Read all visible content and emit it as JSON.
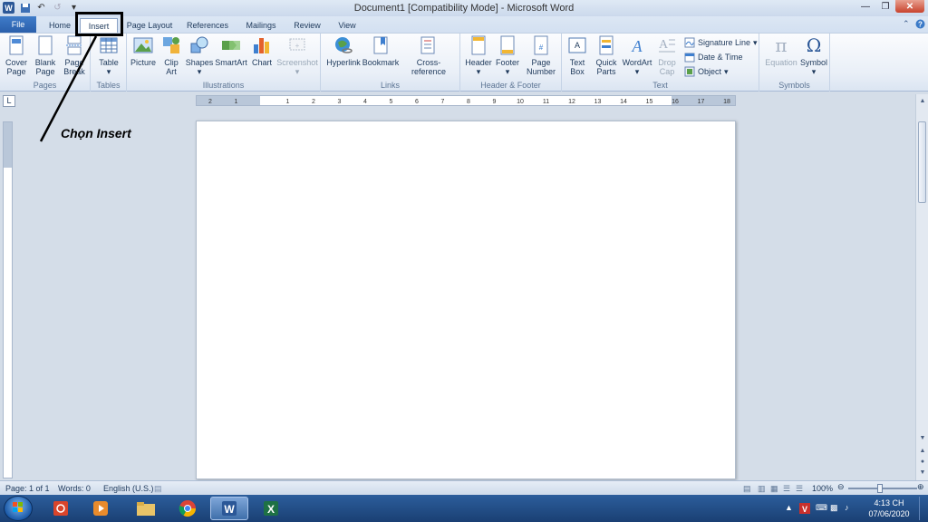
{
  "window": {
    "title": "Document1 [Compatibility Mode] - Microsoft Word",
    "app_icon": "word-icon"
  },
  "tabs": [
    {
      "label": "File"
    },
    {
      "label": "Home"
    },
    {
      "label": "Insert",
      "selected": true
    },
    {
      "label": "Page Layout"
    },
    {
      "label": "References"
    },
    {
      "label": "Mailings"
    },
    {
      "label": "Review"
    },
    {
      "label": "View"
    }
  ],
  "ribbon": {
    "groups": {
      "pages": "Pages",
      "tables": "Tables",
      "illustrations": "Illustrations",
      "links": "Links",
      "header_footer": "Header & Footer",
      "text": "Text",
      "symbols": "Symbols"
    },
    "buttons": {
      "cover_page": [
        "Cover",
        "Page"
      ],
      "blank_page": [
        "Blank",
        "Page"
      ],
      "page_break": [
        "Page",
        "Break"
      ],
      "table": "Table",
      "picture": "Picture",
      "clip_art": [
        "Clip",
        "Art"
      ],
      "shapes": "Shapes",
      "smartart": "SmartArt",
      "chart": "Chart",
      "screenshot": "Screenshot",
      "hyperlink": "Hyperlink",
      "bookmark": "Bookmark",
      "cross_reference": "Cross-reference",
      "header": "Header",
      "footer": "Footer",
      "page_number": [
        "Page",
        "Number"
      ],
      "text_box": [
        "Text",
        "Box"
      ],
      "quick_parts": [
        "Quick",
        "Parts"
      ],
      "wordart": "WordArt",
      "drop_cap": [
        "Drop",
        "Cap"
      ],
      "signature_line": "Signature Line",
      "date_time": "Date & Time",
      "object": "Object",
      "equation": "Equation",
      "symbol": "Symbol"
    }
  },
  "ruler": {
    "ticks": [
      "2",
      "1",
      "1",
      "2",
      "3",
      "4",
      "5",
      "6",
      "7",
      "8",
      "9",
      "10",
      "11",
      "12",
      "13",
      "14",
      "15",
      "16",
      "17",
      "18"
    ]
  },
  "status": {
    "page": "Page: 1 of 1",
    "words": "Words: 0",
    "language": "English (U.S.)",
    "zoom": "100%"
  },
  "taskbar": {
    "time": "4:13 CH",
    "date": "07/06/2020"
  },
  "annotation": {
    "text": "Chọn Insert"
  },
  "colors": {
    "file_tab": "#2a5fab",
    "taskbar": "#1a3f73",
    "close_button": "#c8422c"
  }
}
